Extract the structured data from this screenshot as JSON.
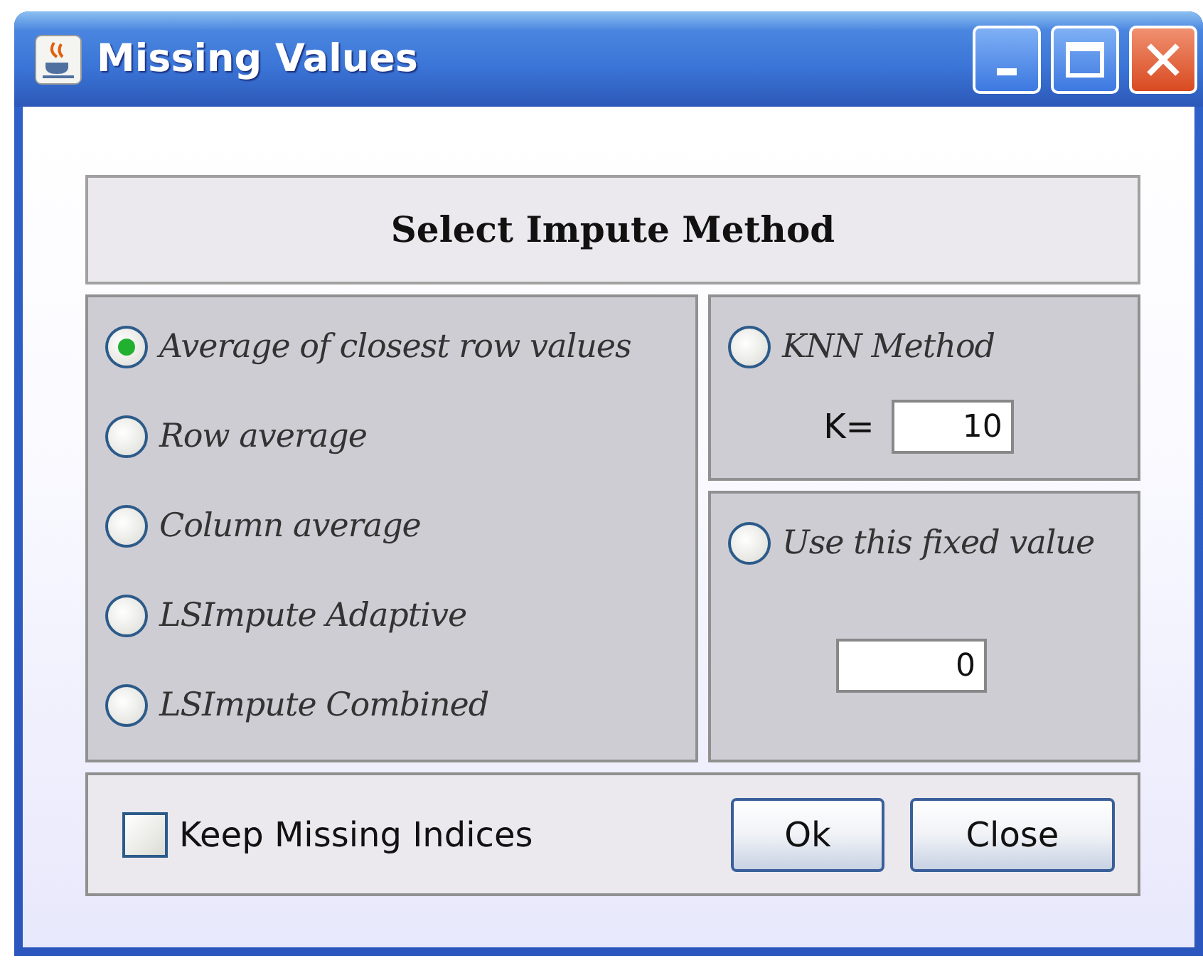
{
  "window": {
    "title": "Missing Values"
  },
  "heading": "Select Impute Method",
  "methods": [
    {
      "label": "Average of closest row values",
      "selected": true
    },
    {
      "label": "Row average",
      "selected": false
    },
    {
      "label": "Column average",
      "selected": false
    },
    {
      "label": "LSImpute Adaptive",
      "selected": false
    },
    {
      "label": "LSImpute Combined",
      "selected": false
    }
  ],
  "knn": {
    "label": "KNN Method",
    "selected": false,
    "k_label": "K=",
    "k_value": "10"
  },
  "fixed": {
    "label": "Use this fixed value",
    "selected": false,
    "value": "0"
  },
  "keep_missing": {
    "label": "Keep Missing Indices",
    "checked": false
  },
  "buttons": [
    "Ok",
    "Close"
  ]
}
